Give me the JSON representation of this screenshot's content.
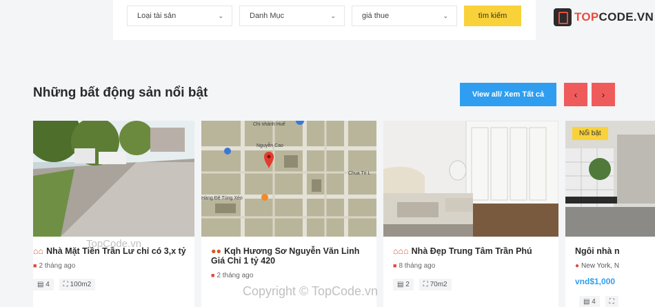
{
  "search": {
    "type_select": "Loại tài sản",
    "category_select": "Danh Mục",
    "price_select": "giá thue",
    "submit_label": "tìm kiếm"
  },
  "logo": {
    "part1": "TOP",
    "part2": "CODE.VN"
  },
  "section": {
    "title": "Những bất động sản nổi bật",
    "view_all_label": "View all/ Xem Tất cả",
    "prev_icon": "‹",
    "next_icon": "›"
  },
  "cards": [
    {
      "title": "Nhà Mặt Tiền Trần Lư chỉ có 3,x tỷ",
      "date": "2 tháng ago",
      "beds": "4",
      "area": "100m2"
    },
    {
      "title": "Kqh Hương Sơ Nguyễn Văn Linh Giá Chỉ 1 tỷ 420",
      "date": "2 tháng ago"
    },
    {
      "title": "Nhà Đẹp Trung Tâm Trần Phú",
      "date": "8 tháng ago",
      "beds": "2",
      "area": "70m2"
    },
    {
      "badge": "Nổi bật",
      "title": "Ngôi nhà n",
      "location": "New York, N",
      "price": "vnd$1,000",
      "beds": "4"
    }
  ],
  "map_labels": {
    "l1": "Chi nhánh Huế",
    "l2": "Nguyễn Cao",
    "l3": "Hàng Đệ Tùng Xẻo",
    "l4": "Chua Tri L"
  },
  "watermarks": {
    "w1": "TopCode.vn",
    "w2": "Copyright © TopCode.vn"
  }
}
